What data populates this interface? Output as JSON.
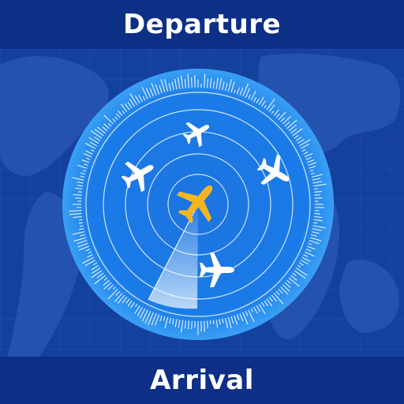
{
  "header": {
    "title": "Departure"
  },
  "footer": {
    "title": "Arrival"
  },
  "radar": {
    "own_plane_color": "#f5b621",
    "other_plane_color": "#ffffff",
    "icons": [
      "airplane-icon"
    ]
  },
  "colors": {
    "bar": "#0d2f86",
    "map": "#14409e",
    "radar_inner": "#1a7be8",
    "radar_outer": "#3296f2"
  }
}
